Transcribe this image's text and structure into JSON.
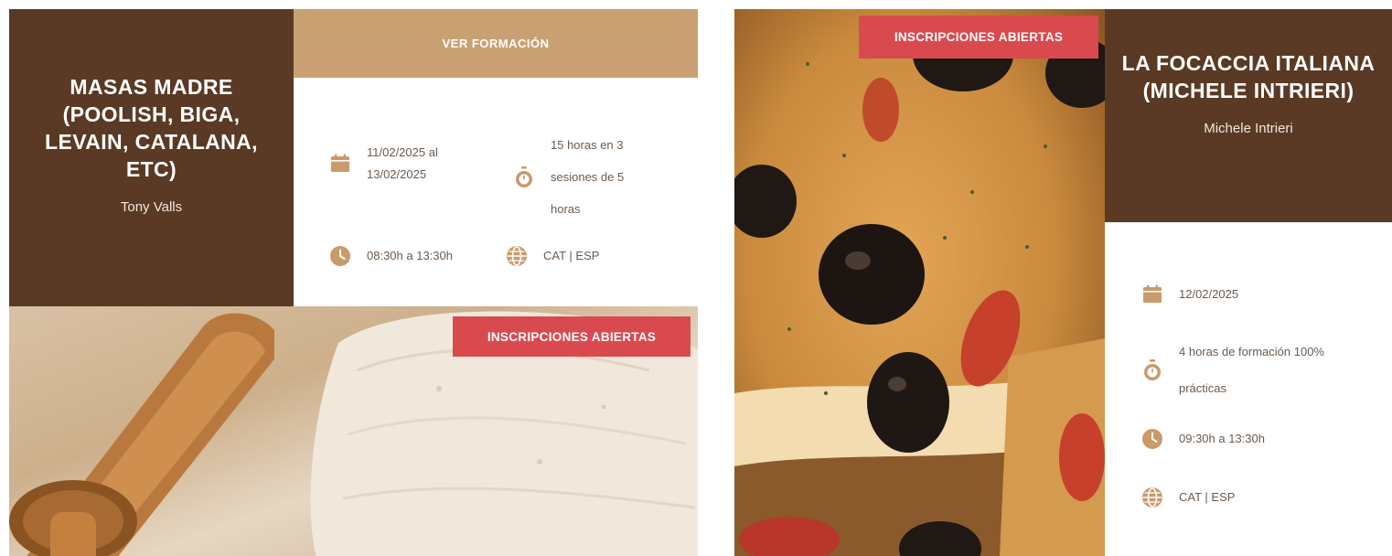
{
  "colors": {
    "brown": "#5a3a24",
    "tan": "#c9a072",
    "badge_red": "#d94a4f",
    "icon_tan": "#c99a6a"
  },
  "card1": {
    "title": "MASAS MADRE (POOLISH, BIGA, LEVAIN, CATALANA, ETC)",
    "author": "Tony Valls",
    "cta_label": "VER FORMACIÓN",
    "date_line1": "11/02/2025 al",
    "date_line2": "13/02/2025",
    "duration_line1": "15 horas en 3",
    "duration_line2": "sesiones de 5",
    "duration_line3": "horas",
    "time": "08:30h a 13:30h",
    "language": "CAT | ESP",
    "badge": "INSCRIPCIONES ABIERTAS",
    "icons": [
      "calendar-icon",
      "stopwatch-icon",
      "clock-icon",
      "globe-icon"
    ]
  },
  "card2": {
    "badge": "INSCRIPCIONES ABIERTAS",
    "title": "LA FOCACCIA ITALIANA (MICHELE INTRIERI)",
    "author": "Michele Intrieri",
    "date": "12/02/2025",
    "duration_line1": "4 horas de formación 100%",
    "duration_line2": "prácticas",
    "time": "09:30h a 13:30h",
    "language": "CAT | ESP",
    "icons": [
      "calendar-icon",
      "stopwatch-icon",
      "clock-icon",
      "globe-icon"
    ]
  }
}
